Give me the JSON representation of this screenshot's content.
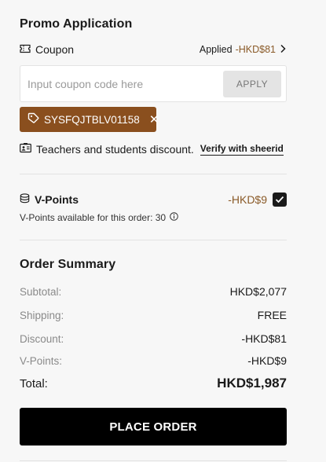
{
  "promo": {
    "title": "Promo Application",
    "coupon_label": "Coupon",
    "applied_label": "Applied",
    "applied_amount": "-HKD$81",
    "input_placeholder": "Input coupon code here",
    "input_value": "",
    "apply_label": "APPLY",
    "coupon_code": "SYSFQJTBLV01158",
    "edu_text": "Teachers and students discount.",
    "edu_link": "Verify with sheerid"
  },
  "vpoints": {
    "label": "V-Points",
    "amount": "-HKD$9",
    "checked": true,
    "available_text": "V-Points available for this order: 30"
  },
  "summary": {
    "title": "Order Summary",
    "rows": [
      {
        "label": "Subtotal:",
        "value": "HKD$2,077"
      },
      {
        "label": "Shipping:",
        "value": "FREE"
      },
      {
        "label": "Discount:",
        "value": "-HKD$81"
      },
      {
        "label": "V-Points:",
        "value": "-HKD$9"
      }
    ],
    "total_label": "Total:",
    "total_value": "HKD$1,987"
  },
  "place_order_label": "PLACE ORDER",
  "colors": {
    "accent_brown": "#8a5a28",
    "tag_brown": "#8a4f1e",
    "button_black": "#000000"
  },
  "icons": [
    "ticket-icon",
    "chevron-right-icon",
    "tag-icon",
    "close-icon",
    "id-card-icon",
    "coins-icon",
    "checkmark-icon",
    "info-icon"
  ]
}
